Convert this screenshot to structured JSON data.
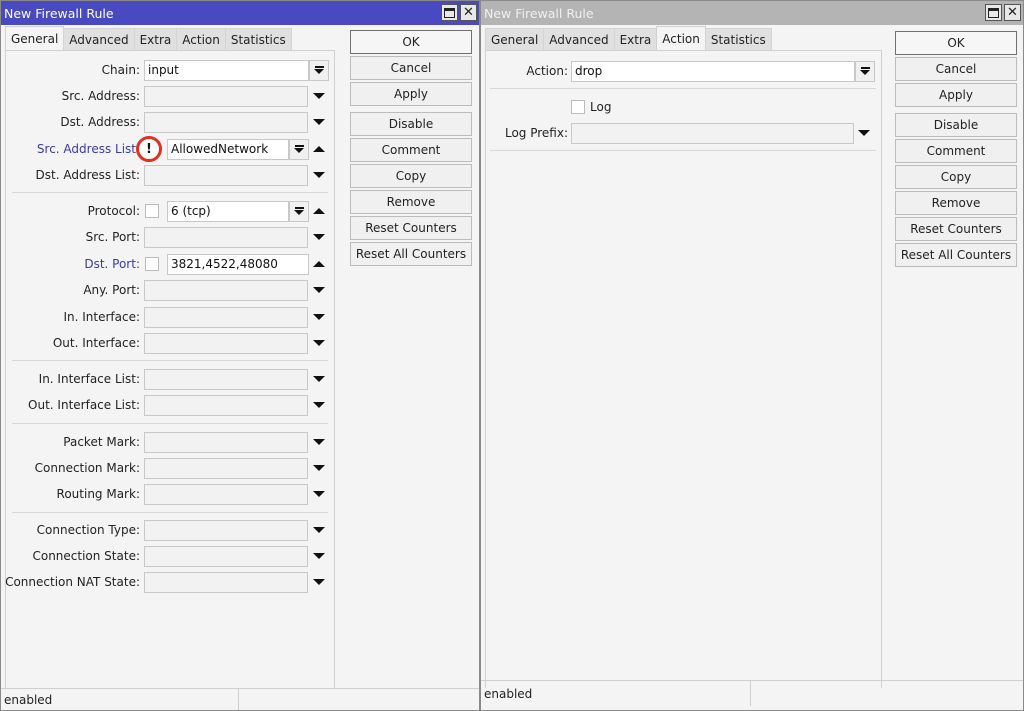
{
  "left_window": {
    "title": "New Firewall Rule",
    "tabs": [
      {
        "label": "General",
        "active": true
      },
      {
        "label": "Advanced",
        "active": false
      },
      {
        "label": "Extra",
        "active": false
      },
      {
        "label": "Action",
        "active": false
      },
      {
        "label": "Statistics",
        "active": false
      }
    ],
    "fields": {
      "chain": {
        "label": "Chain:",
        "value": "input"
      },
      "src_address": {
        "label": "Src. Address:",
        "value": ""
      },
      "dst_address": {
        "label": "Dst. Address:",
        "value": ""
      },
      "src_address_list": {
        "label": "Src. Address List",
        "value": "AllowedNetwork",
        "negate_marker": "!"
      },
      "dst_address_list": {
        "label": "Dst. Address List:",
        "value": ""
      },
      "protocol": {
        "label": "Protocol:",
        "value": "6 (tcp)"
      },
      "src_port": {
        "label": "Src. Port:",
        "value": ""
      },
      "dst_port": {
        "label": "Dst. Port:",
        "value": "3821,4522,48080"
      },
      "any_port": {
        "label": "Any. Port:",
        "value": ""
      },
      "in_interface": {
        "label": "In. Interface:",
        "value": ""
      },
      "out_interface": {
        "label": "Out. Interface:",
        "value": ""
      },
      "in_interface_list": {
        "label": "In. Interface List:",
        "value": ""
      },
      "out_interface_list": {
        "label": "Out. Interface List:",
        "value": ""
      },
      "packet_mark": {
        "label": "Packet Mark:",
        "value": ""
      },
      "connection_mark": {
        "label": "Connection Mark:",
        "value": ""
      },
      "routing_mark": {
        "label": "Routing Mark:",
        "value": ""
      },
      "connection_type": {
        "label": "Connection Type:",
        "value": ""
      },
      "connection_state": {
        "label": "Connection State:",
        "value": ""
      },
      "connection_nat_state": {
        "label": "Connection NAT State:",
        "value": ""
      }
    },
    "buttons": [
      "OK",
      "Cancel",
      "Apply",
      "Disable",
      "Comment",
      "Copy",
      "Remove",
      "Reset Counters",
      "Reset All Counters"
    ],
    "status": "enabled"
  },
  "right_window": {
    "title": "New Firewall Rule",
    "tabs": [
      {
        "label": "General",
        "active": false
      },
      {
        "label": "Advanced",
        "active": false
      },
      {
        "label": "Extra",
        "active": false
      },
      {
        "label": "Action",
        "active": true
      },
      {
        "label": "Statistics",
        "active": false
      }
    ],
    "fields": {
      "action": {
        "label": "Action:",
        "value": "drop"
      },
      "log": {
        "label": "Log",
        "checked": false
      },
      "log_prefix": {
        "label": "Log Prefix:",
        "value": ""
      }
    },
    "buttons": [
      "OK",
      "Cancel",
      "Apply",
      "Disable",
      "Comment",
      "Copy",
      "Remove",
      "Reset Counters",
      "Reset All Counters"
    ],
    "status": "enabled"
  },
  "colors": {
    "active_title": "#4a4ac0",
    "inactive_title": "#b4b4b4",
    "highlight_label": "#3a3aa8",
    "annotation_circle": "#e0301e"
  }
}
